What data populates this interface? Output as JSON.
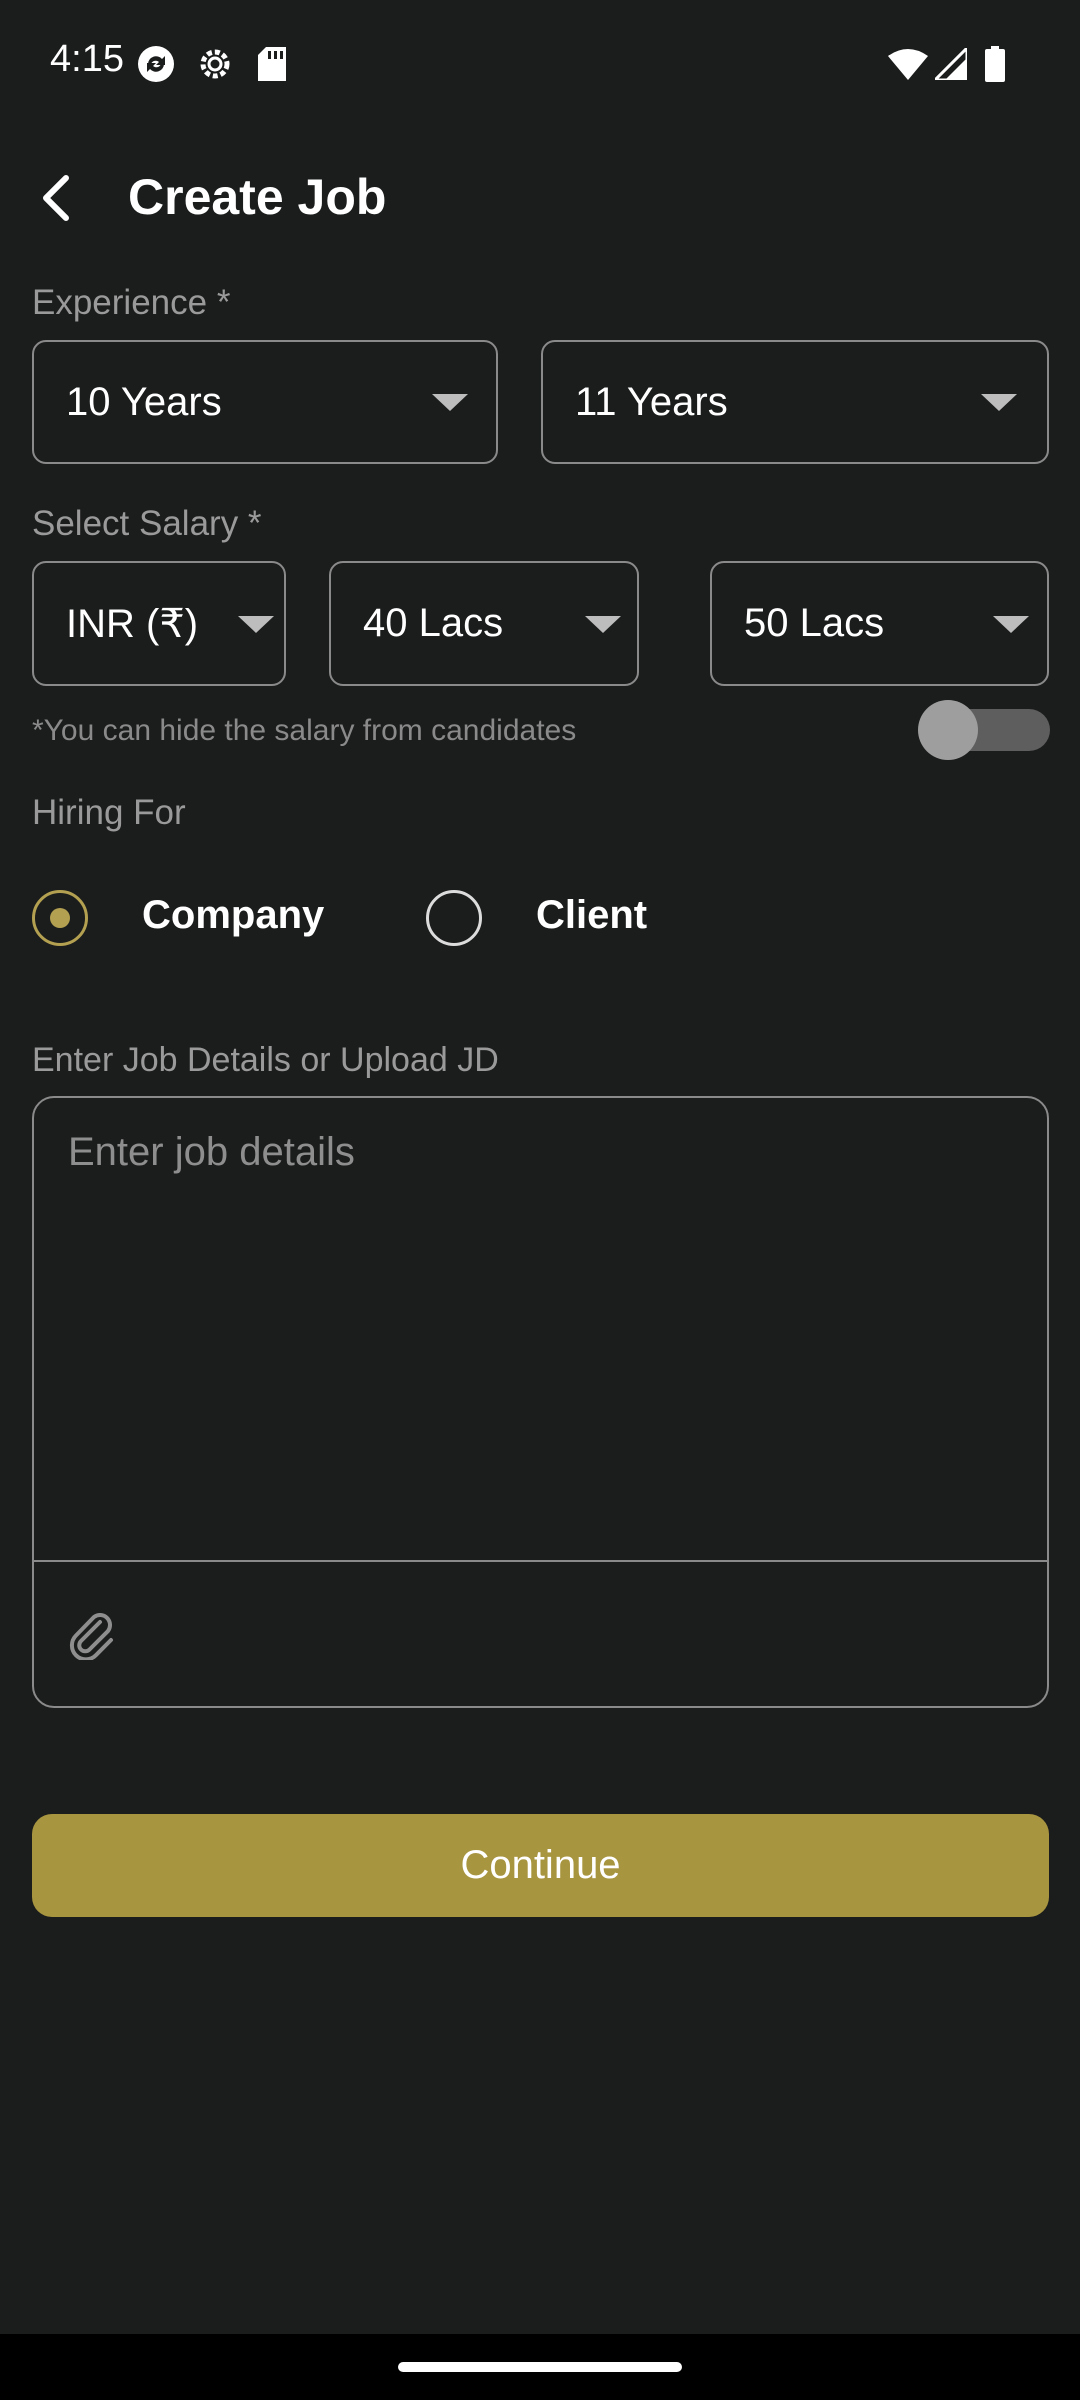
{
  "status_bar": {
    "time": "4:15",
    "icons": [
      "sync-icon",
      "settings-icon",
      "sd-card-icon",
      "wifi-icon",
      "signal-icon",
      "battery-icon"
    ]
  },
  "header": {
    "title": "Create Job",
    "back_icon": "back-arrow-icon"
  },
  "experience": {
    "label": "Experience *",
    "min": "10 Years",
    "max": "11 Years"
  },
  "salary": {
    "label": "Select Salary *",
    "currency": "INR (₹)",
    "min": "40 Lacs",
    "max": "50 Lacs",
    "hide_hint": "*You can hide the salary from candidates",
    "hide_enabled": false
  },
  "hiring_for": {
    "label": "Hiring For",
    "options": [
      {
        "label": "Company",
        "selected": true
      },
      {
        "label": "Client",
        "selected": false
      }
    ]
  },
  "job_details": {
    "label": "Enter Job Details or Upload JD",
    "placeholder": "Enter job details",
    "value": "",
    "attach_icon": "paperclip-icon"
  },
  "continue_label": "Continue",
  "colors": {
    "background": "#1b1c1c",
    "accent": "#a89540",
    "radio_selected": "#b3a050",
    "border": "#8a8a8a"
  }
}
